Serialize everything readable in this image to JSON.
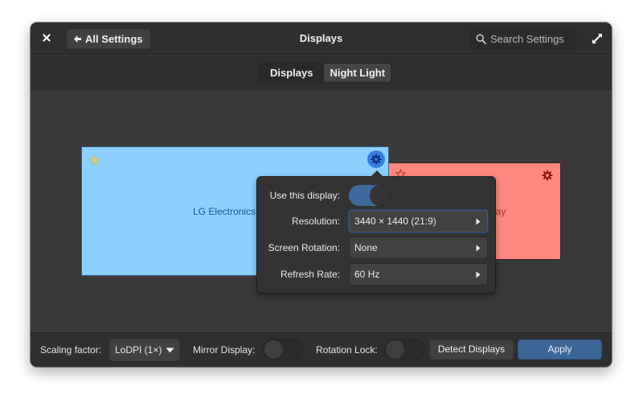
{
  "window": {
    "title": "Displays",
    "close_icon": "close-icon",
    "maximize_icon": "maximize-icon"
  },
  "header": {
    "back_label": "All Settings",
    "search_placeholder": "Search Settings",
    "search_value": ""
  },
  "tabs": [
    {
      "label": "Displays",
      "active": true
    },
    {
      "label": "Night Light",
      "active": false
    }
  ],
  "monitors": [
    {
      "name": "LG Electronics",
      "primary": true,
      "color": "#8cd1ff"
    },
    {
      "name": "Built-in Display",
      "visible_text": "lay",
      "primary": false,
      "color": "#ff8880"
    }
  ],
  "popover": {
    "use_display_label": "Use this display:",
    "use_display_on": true,
    "resolution_label": "Resolution:",
    "resolution_value": "3440 × 1440 (21:9)",
    "rotation_label": "Screen Rotation:",
    "rotation_value": "None",
    "refresh_label": "Refresh Rate:",
    "refresh_value": "60 Hz"
  },
  "footer": {
    "scaling_label": "Scaling factor:",
    "scaling_value": "LoDPI (1×)",
    "mirror_label": "Mirror Display:",
    "mirror_on": false,
    "rotation_lock_label": "Rotation Lock:",
    "rotation_lock_on": false,
    "detect_label": "Detect Displays",
    "apply_label": "Apply"
  },
  "colors": {
    "accent": "#3b6695",
    "primary_monitor": "#8cd1ff",
    "secondary_monitor": "#ff8880"
  }
}
